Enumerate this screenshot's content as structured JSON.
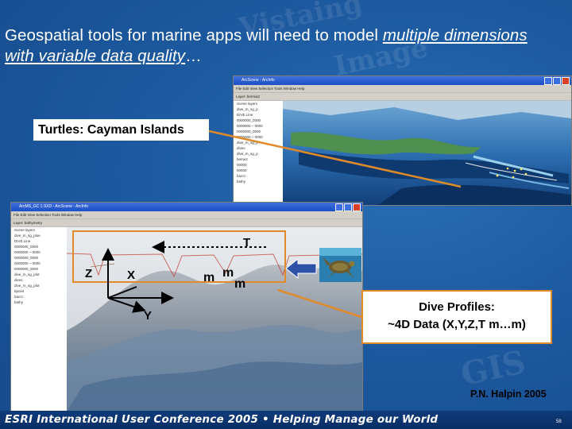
{
  "slide": {
    "title_plain": "Geospatial tools for marine apps will need to model ",
    "title_emph": "multiple dimensions with variable data quality",
    "title_tail": "…",
    "turtles_label": "Turtles: Cayman Islands",
    "dive_line1": "Dive Profiles:",
    "dive_line2": "~4D Data (X,Y,Z,T m…m)",
    "author": "P.N. Halpin 2005",
    "footer": "ESRI International User Conference 2005 • Helping Manage our World",
    "page_number": "58",
    "watermark_words": [
      "Vistaing",
      "Image",
      "GIS"
    ]
  },
  "window_top": {
    "title": "ArcScene - ArcInfo",
    "menu": "File  Edit  View  Selection  Tools  Window  Help",
    "toolbar_layer": "Layer: bermia2",
    "toc_items": [
      "Scene layers",
      "dive_m_sg_p",
      "DIVE.Line",
      "0000000_0000",
      "0000000 ~ 0000",
      "0000000_0000",
      "0000000 ~ 0000",
      "dive_m_sg_p",
      "dives",
      "dive_m_sg_p",
      "beme2",
      "00000",
      "00000",
      "bacct",
      "bathy"
    ]
  },
  "window_front": {
    "title": "ArcMS_GC 1.SXD - ArcScene - ArcInfo",
    "menu": "File  Edit  View  Selection  Tools  Window  Help",
    "toolbar_layer": "Layer: bathymetry",
    "toc_items": [
      "Scene layers",
      "dive_m_sg_ploe",
      "DIVE.Line",
      "0000000_0000",
      "0000000 ~ 0000",
      "0000000_0000",
      "0000000 ~ 0000",
      "0000000_0000",
      "dive_m_sg_plot",
      "dives",
      "dive_m_sg_plot",
      "bpoint",
      "bacct",
      "bathy"
    ]
  },
  "axes": {
    "t": "T",
    "z": "Z",
    "x": "X",
    "y": "Y",
    "m": "m"
  },
  "colors": {
    "accent": "#e08a2a",
    "background": "#1d5aa0",
    "footer": "#0a2f66"
  }
}
